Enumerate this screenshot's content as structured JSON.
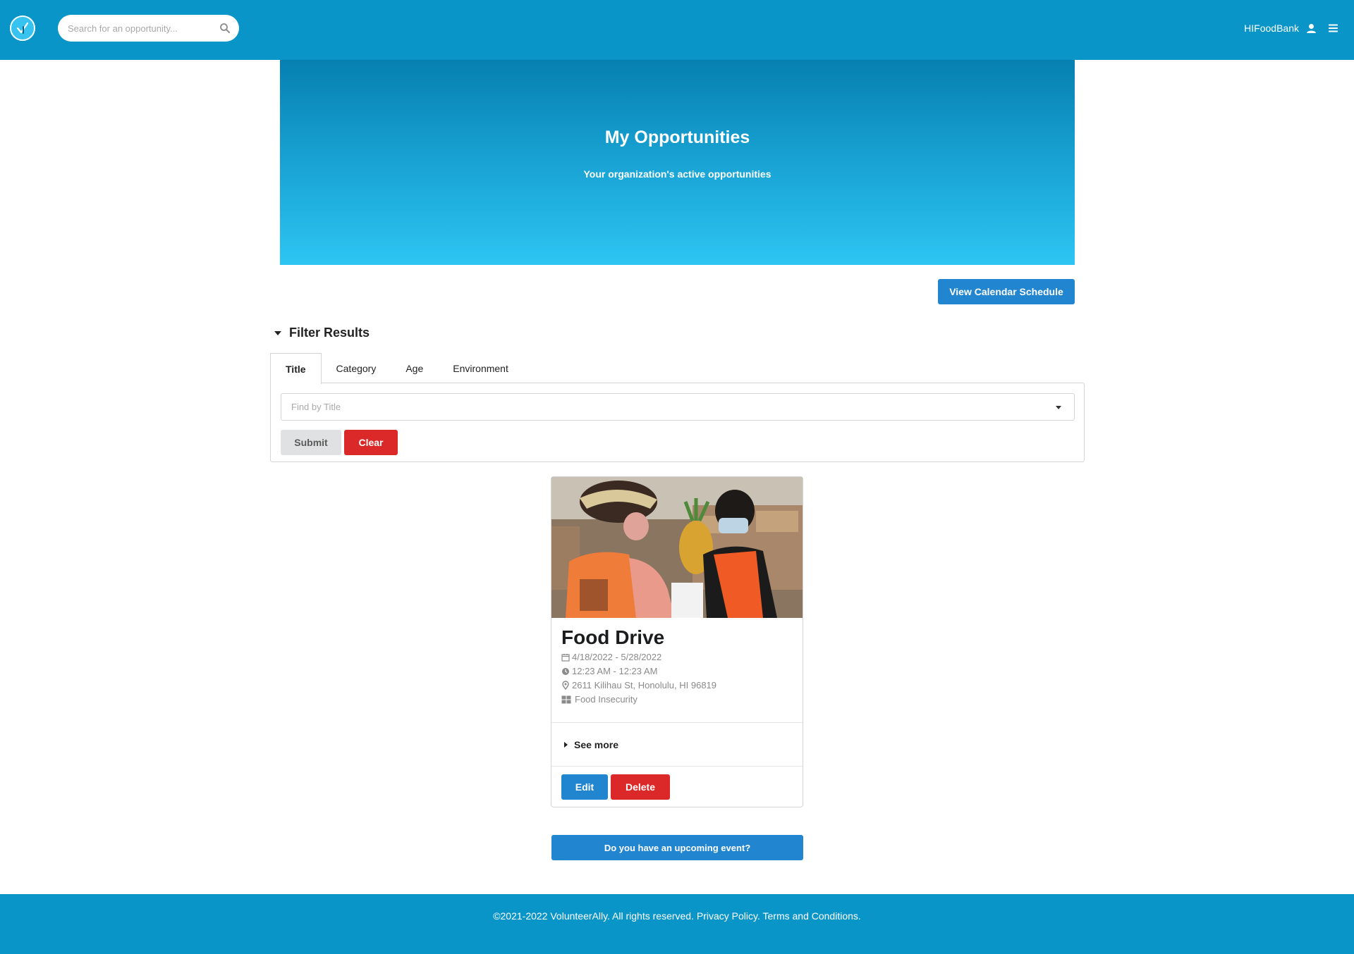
{
  "header": {
    "logo_icon": "volunteerally-check-logo-icon",
    "search_placeholder": "Search for an opportunity...",
    "search_icon": "search-icon",
    "username": "HIFoodBank",
    "user_icon": "user-icon",
    "menu_icon": "hamburger-menu-icon"
  },
  "hero": {
    "title": "My Opportunities",
    "subtitle": "Your organization's active opportunities"
  },
  "actions": {
    "calendar_label": "View Calendar Schedule"
  },
  "filter": {
    "heading": "Filter Results",
    "tabs": [
      {
        "label": "Title",
        "active": true
      },
      {
        "label": "Category",
        "active": false
      },
      {
        "label": "Age",
        "active": false
      },
      {
        "label": "Environment",
        "active": false
      }
    ],
    "select_placeholder": "Find by Title",
    "submit_label": "Submit",
    "clear_label": "Clear"
  },
  "opportunity": {
    "title": "Food Drive",
    "dates": "4/18/2022 - 5/28/2022",
    "time": "12:23 AM - 12:23 AM",
    "address": "2611 Kilihau St, Honolulu, HI 96819",
    "category": "Food Insecurity",
    "see_more_label": "See more",
    "edit_label": "Edit",
    "delete_label": "Delete"
  },
  "event_prompt_label": "Do you have an upcoming event?",
  "footer": {
    "copyright": "©2021-2022 VolunteerAlly. All rights reserved.",
    "privacy_label": "Privacy Policy.",
    "terms_label": "Terms and Conditions."
  },
  "colors": {
    "header_bg": "#0a95c9",
    "primary_blue": "#2185d0",
    "danger_red": "#db2828",
    "hero_top": "#0680b0",
    "hero_bottom": "#2ec5f3"
  }
}
